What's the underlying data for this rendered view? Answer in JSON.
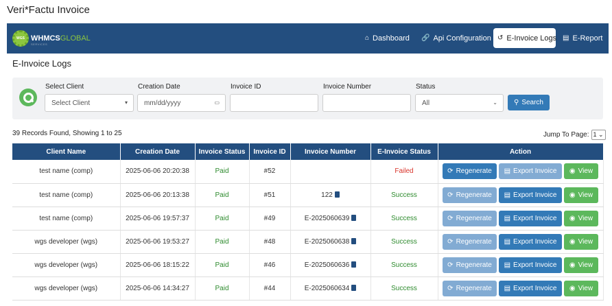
{
  "app_title": "Veri*Factu Invoice",
  "navbar": {
    "logo_text_main": "WHMCS",
    "logo_text_accent": "GLOBAL",
    "logo_sub": "SERVICES",
    "logo_badge": "WGS",
    "items": [
      {
        "label": "Dashboard",
        "icon": "home-icon"
      },
      {
        "label": "Api Configuration",
        "icon": "link-icon"
      },
      {
        "label": "E-Invoice Logs",
        "icon": "history-icon",
        "active": true
      },
      {
        "label": "E-Report",
        "icon": "file-icon"
      }
    ]
  },
  "page_title": "E-Invoice Logs",
  "filters": {
    "client_label": "Select Client",
    "client_value": "Select Client",
    "date_label": "Creation Date",
    "date_placeholder": "mm/dd/yyyy",
    "invoice_id_label": "Invoice ID",
    "invoice_id_value": "",
    "invoice_number_label": "Invoice Number",
    "invoice_number_value": "",
    "status_label": "Status",
    "status_value": "All",
    "search_label": "Search"
  },
  "records_text": "39 Records Found, Showing 1 to 25",
  "jump": {
    "label": "Jump To Page:",
    "value": "1"
  },
  "table": {
    "headers": [
      "Client Name",
      "Creation Date",
      "Invoice Status",
      "Invoice ID",
      "Invoice Number",
      "E-Invoice Status",
      "Action"
    ],
    "actions": {
      "regenerate": "Regenerate",
      "export": "Export Invoice",
      "view": "View"
    },
    "rows": [
      {
        "client": "test name (comp)",
        "date": "2025-06-06 20:20:38",
        "status": "Paid",
        "id": "#52",
        "number": "",
        "einvoice": "Failed"
      },
      {
        "client": "test name (comp)",
        "date": "2025-06-06 20:13:38",
        "status": "Paid",
        "id": "#51",
        "number": "122",
        "einvoice": "Success"
      },
      {
        "client": "test name (comp)",
        "date": "2025-06-06 19:57:37",
        "status": "Paid",
        "id": "#49",
        "number": "E-2025060639",
        "einvoice": "Success"
      },
      {
        "client": "wgs developer (wgs)",
        "date": "2025-06-06 19:53:27",
        "status": "Paid",
        "id": "#48",
        "number": "E-2025060638",
        "einvoice": "Success"
      },
      {
        "client": "wgs developer (wgs)",
        "date": "2025-06-06 18:15:22",
        "status": "Paid",
        "id": "#46",
        "number": "E-2025060636",
        "einvoice": "Success"
      },
      {
        "client": "wgs developer (wgs)",
        "date": "2025-06-06 14:34:27",
        "status": "Paid",
        "id": "#44",
        "number": "E-2025060634",
        "einvoice": "Success"
      }
    ]
  },
  "colors": {
    "nav": "#234e7f",
    "primary": "#337ab7",
    "primary_light": "#82abd3",
    "success": "#5cb85c",
    "failed": "#d9342b"
  }
}
